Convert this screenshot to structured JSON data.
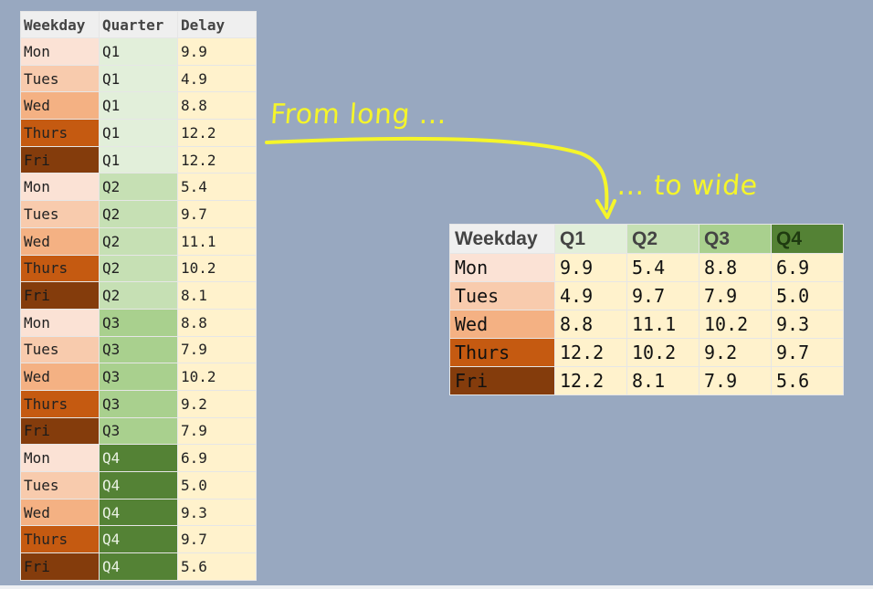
{
  "colors": {
    "background": "#98a8c0",
    "header_bg": "#efefef",
    "value_bg": "#fff2cc",
    "annotation": "#f5f52a",
    "weekday": {
      "Mon": "#fbe2d5",
      "Tues": "#f8cbad",
      "Wed": "#f4b183",
      "Thurs": "#c55a11",
      "Fri": "#843c0c"
    },
    "quarter": {
      "Q1": "#e2efda",
      "Q2": "#c6e0b4",
      "Q3": "#a9d08e",
      "Q4": "#548235"
    }
  },
  "long_table": {
    "headers": [
      "Weekday",
      "Quarter",
      "Delay"
    ],
    "rows": [
      [
        "Mon",
        "Q1",
        "9.9"
      ],
      [
        "Tues",
        "Q1",
        "4.9"
      ],
      [
        "Wed",
        "Q1",
        "8.8"
      ],
      [
        "Thurs",
        "Q1",
        "12.2"
      ],
      [
        "Fri",
        "Q1",
        "12.2"
      ],
      [
        "Mon",
        "Q2",
        "5.4"
      ],
      [
        "Tues",
        "Q2",
        "9.7"
      ],
      [
        "Wed",
        "Q2",
        "11.1"
      ],
      [
        "Thurs",
        "Q2",
        "10.2"
      ],
      [
        "Fri",
        "Q2",
        "8.1"
      ],
      [
        "Mon",
        "Q3",
        "8.8"
      ],
      [
        "Tues",
        "Q3",
        "7.9"
      ],
      [
        "Wed",
        "Q3",
        "10.2"
      ],
      [
        "Thurs",
        "Q3",
        "9.2"
      ],
      [
        "Fri",
        "Q3",
        "7.9"
      ],
      [
        "Mon",
        "Q4",
        "6.9"
      ],
      [
        "Tues",
        "Q4",
        "5.0"
      ],
      [
        "Wed",
        "Q4",
        "9.3"
      ],
      [
        "Thurs",
        "Q4",
        "9.7"
      ],
      [
        "Fri",
        "Q4",
        "5.6"
      ]
    ]
  },
  "wide_table": {
    "headers": [
      "Weekday",
      "Q1",
      "Q2",
      "Q3",
      "Q4"
    ],
    "rows": [
      [
        "Mon",
        "9.9",
        "5.4",
        "8.8",
        "6.9"
      ],
      [
        "Tues",
        "4.9",
        "9.7",
        "7.9",
        "5.0"
      ],
      [
        "Wed",
        "8.8",
        "11.1",
        "10.2",
        "9.3"
      ],
      [
        "Thurs",
        "12.2",
        "10.2",
        "9.2",
        "9.7"
      ],
      [
        "Fri",
        "12.2",
        "8.1",
        "7.9",
        "5.6"
      ]
    ]
  },
  "annotations": {
    "from": "From long ...",
    "to": "... to wide"
  }
}
